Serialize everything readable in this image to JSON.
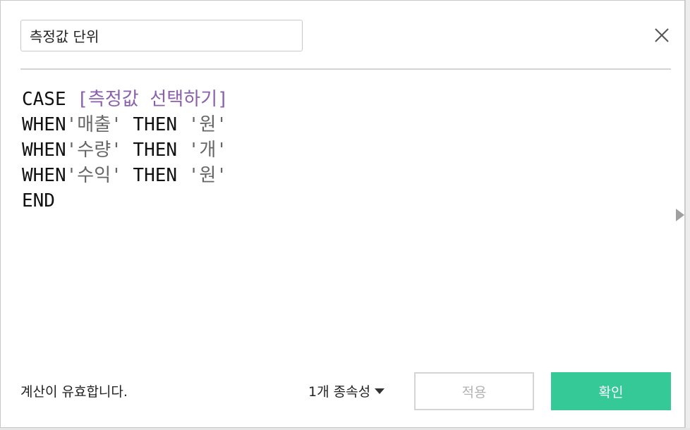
{
  "dialog": {
    "name_value": "측정값 단위",
    "close_icon": "close-icon",
    "expand_icon": "triangle-right-icon"
  },
  "formula": {
    "lines": [
      [
        {
          "t": "CASE ",
          "c": "kw"
        },
        {
          "t": "[측정값 선택하기]",
          "c": "field"
        }
      ],
      [
        {
          "t": "WHEN",
          "c": "kw"
        },
        {
          "t": "'매출'",
          "c": "str"
        },
        {
          "t": " THEN ",
          "c": "kw"
        },
        {
          "t": "'원'",
          "c": "str"
        }
      ],
      [
        {
          "t": "WHEN",
          "c": "kw"
        },
        {
          "t": "'수량'",
          "c": "str"
        },
        {
          "t": " THEN ",
          "c": "kw"
        },
        {
          "t": "'개'",
          "c": "str"
        }
      ],
      [
        {
          "t": "WHEN",
          "c": "kw"
        },
        {
          "t": "'수익'",
          "c": "str"
        },
        {
          "t": " THEN ",
          "c": "kw"
        },
        {
          "t": "'원'",
          "c": "str"
        }
      ],
      [
        {
          "t": "END",
          "c": "kw"
        }
      ]
    ]
  },
  "footer": {
    "status_text": "계산이 유효합니다.",
    "dependencies_label": "1개 종속성",
    "apply_label": "적용",
    "ok_label": "확인"
  },
  "colors": {
    "accent": "#35c997",
    "field_ref": "#8a5fae",
    "string_literal": "#666666"
  }
}
